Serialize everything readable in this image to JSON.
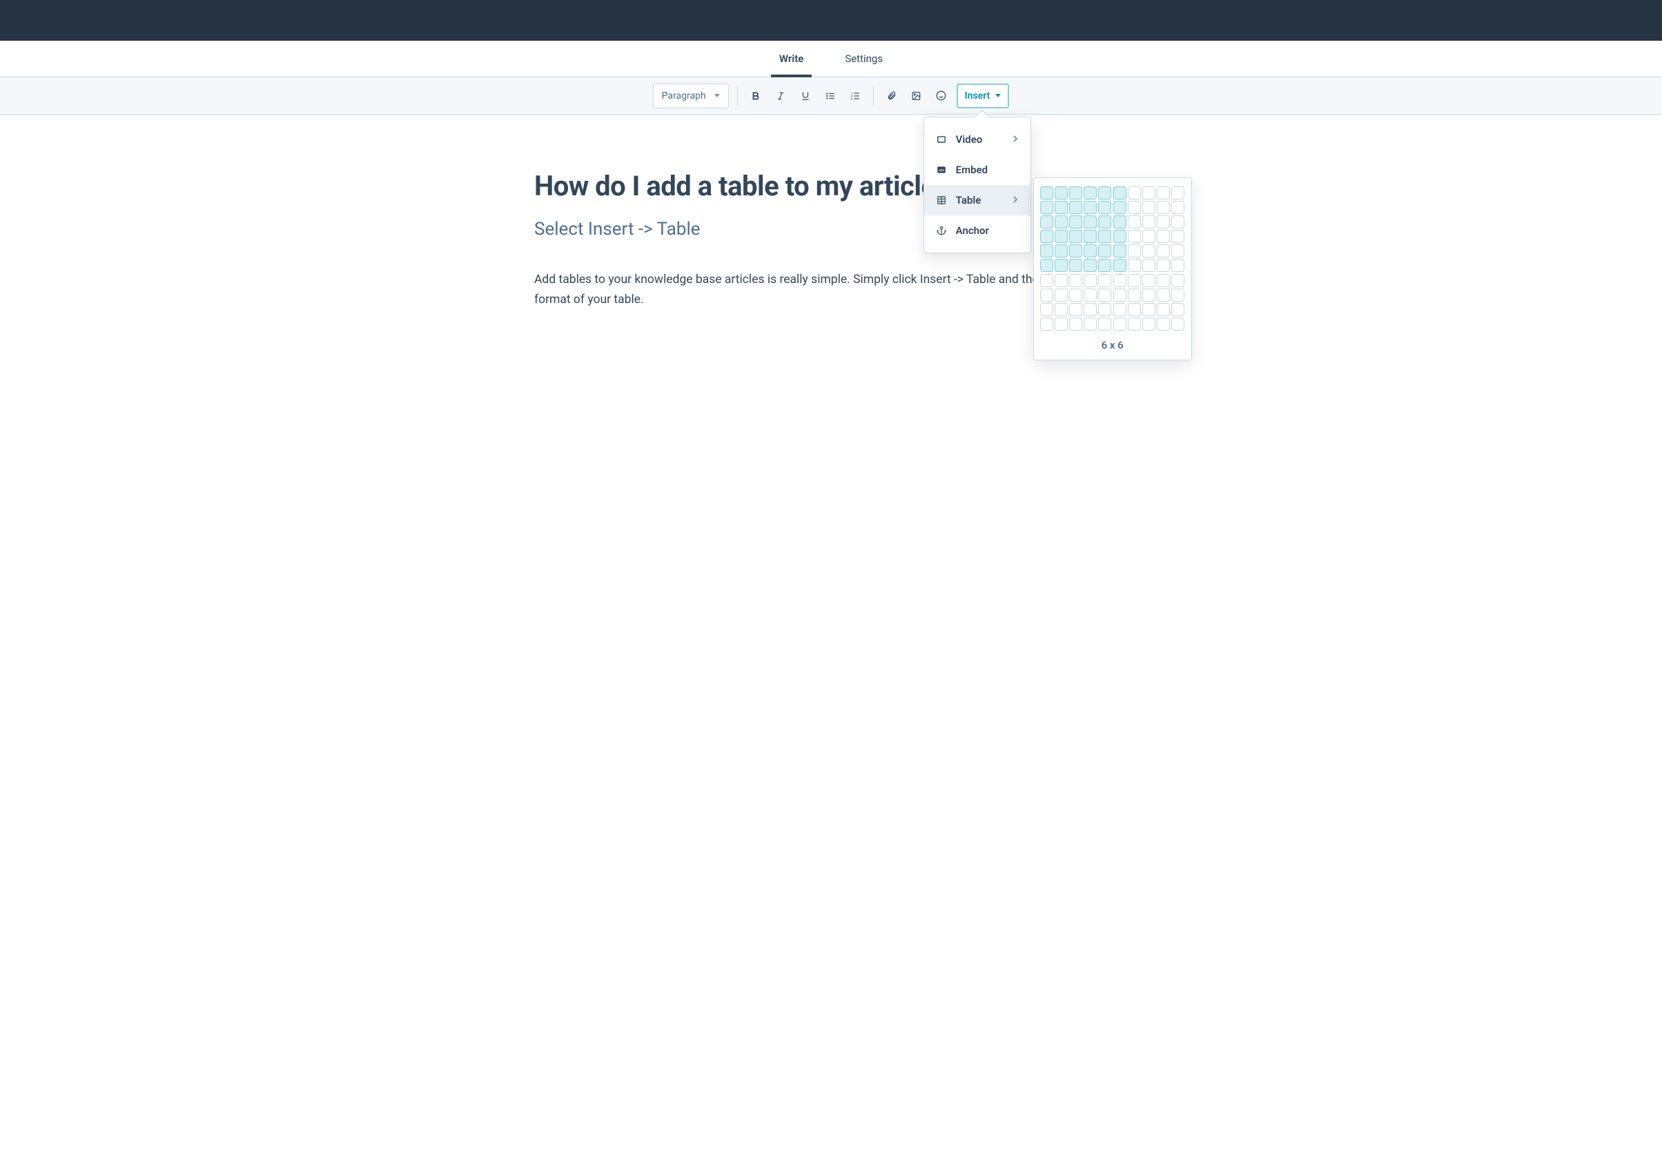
{
  "tabs": {
    "write": "Write",
    "settings": "Settings"
  },
  "toolbar": {
    "paragraph_label": "Paragraph",
    "insert_label": "Insert"
  },
  "insert_menu": {
    "video": "Video",
    "embed": "Embed",
    "table": "Table",
    "anchor": "Anchor"
  },
  "table_picker": {
    "rows": 10,
    "cols": 10,
    "sel_rows": 6,
    "sel_cols": 6,
    "label": "6 x 6"
  },
  "article": {
    "title": "How do I add a table to my article?",
    "subtitle": "Select Insert -> Table",
    "body": "Add tables to your knowledge base articles is really simple. Simply click Insert -> Table and then choose the format of your table."
  }
}
